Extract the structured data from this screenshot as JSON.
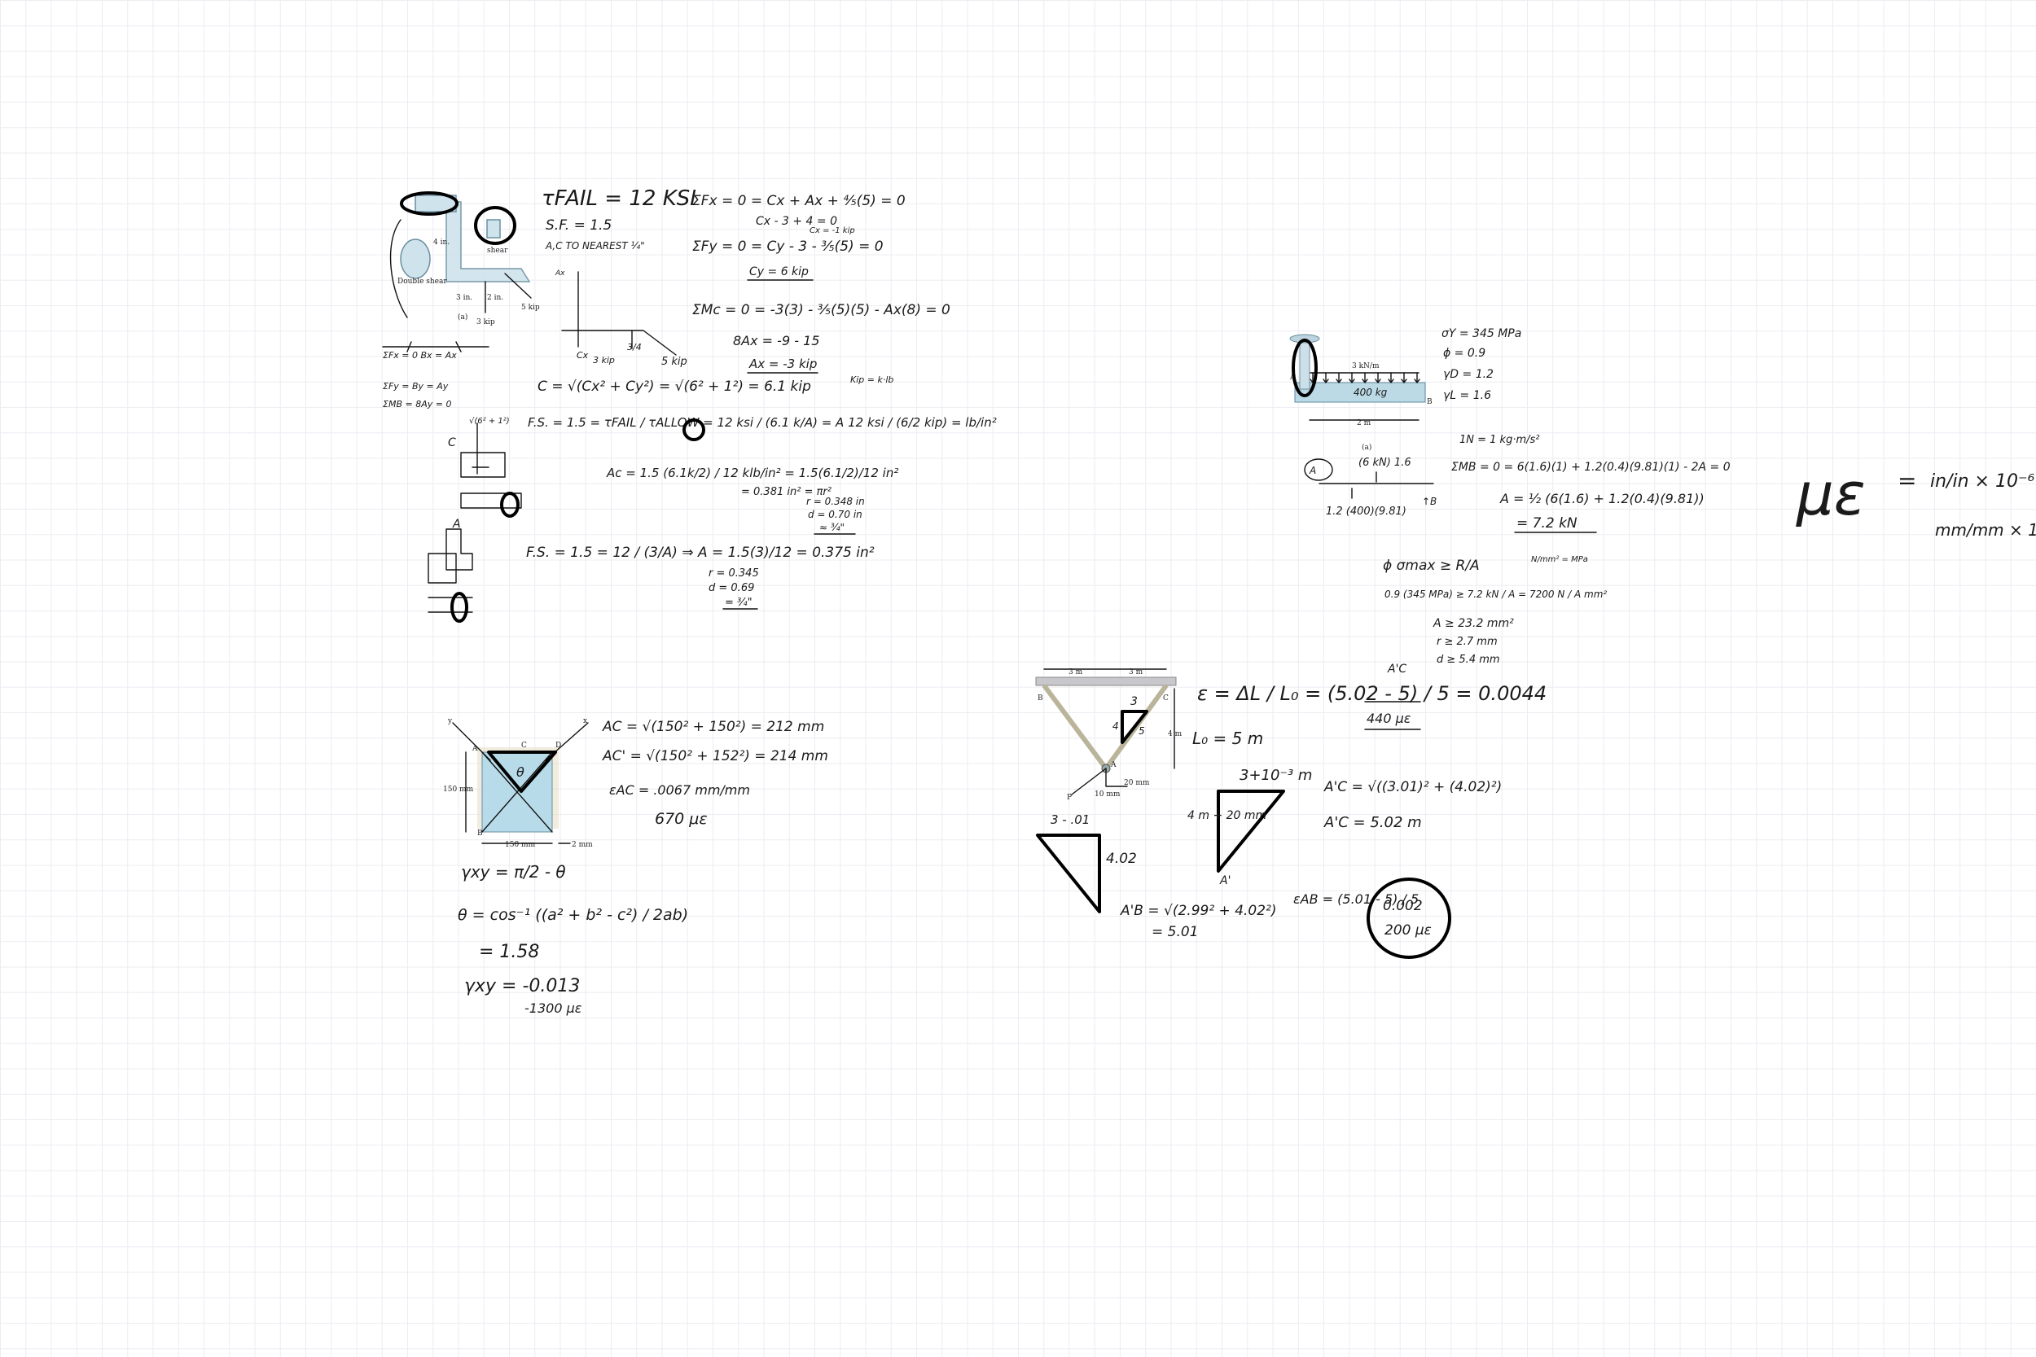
{
  "whiteboard": {
    "problem1": {
      "figure": {
        "caption": "(a)",
        "labels": [
          "shear",
          "Double shear",
          "5 kip",
          "3 kip",
          "3 in.",
          "2 in.",
          "4 in."
        ]
      },
      "notes": {
        "tau_fail": "τFAIL = 12 KSI",
        "sf": "S.F. = 1.5",
        "nearest": "A,C TO NEAREST ¼\"",
        "sum_fx": "ΣFx = 0 = Cx + Ax + ⁴⁄₅(5) = 0",
        "cx_eq": "Cx - 3 + 4 = 0",
        "cx_val": "Cx = -1 kip",
        "sum_fy": "ΣFy = 0 = Cy - 3 - ³⁄₅(5) = 0",
        "cy_val": "Cy = 6 kip",
        "sum_mc": "ΣMc = 0 = -3(3) - ³⁄₅(5)(5) - Ax(8) = 0",
        "ax_eq": "8Ax = -9 - 15",
        "ax_val": "Ax = -3 kip",
        "kip_note": "Kip = k·lb",
        "c_res": "C = √(Cx² + Cy²) = √(6² + 1²) = 6.1 kip",
        "fs_c": "F.S. = 1.5 = τFAIL / τALLOW = 12 ksi / (6.1 k/A) = A 12 ksi / (6/2 kip) = lb/in²",
        "ac_eq": "Ac = 1.5 (6.1k/2) / 12 klb/in² = 1.5(6.1/2)/12 in²",
        "ac_val": "= 0.381 in² = πr²",
        "r_c": "r = 0.348 in",
        "d_c": "d = 0.70 in",
        "d_c_round": "≈ ¾\"",
        "fs_a": "F.S. = 1.5 = 12 / (3/A) ⇒ A = 1.5(3)/12 = 0.375 in²",
        "r_a": "r = 0.345",
        "d_a": "d = 0.69",
        "d_a_round": "= ¾\"",
        "fbd_sum1": "ΣFx = 0   Bx = Ax",
        "fbd_sum2": "ΣFy = By = Ay",
        "fbd_sum3": "ΣMB = 8Ay = 0",
        "fbd_label_c": "C",
        "fbd_label_a": "A",
        "fbd_sqrt": "√(6² + 1²)",
        "kip_5": "5 kip",
        "kip_3": "3 kip",
        "fbd_cx": "Cx",
        "fbd_cy": "Cy",
        "fbd_ax": "Ax",
        "fbd_3_4": "3/4"
      }
    },
    "problem2": {
      "figure": {
        "labels": [
          "3 kN/m",
          "2 m",
          "(a)",
          "A",
          "B"
        ],
        "beam_label": "400 kg"
      },
      "notes": {
        "sigma_y": "σY = 345 MPa",
        "phi": "ϕ = 0.9",
        "gamma_d": "γD = 1.2",
        "gamma_l": "γL = 1.6",
        "newton": "1N = 1 kg·m/s²",
        "load_a": "(6 kN) 1.6",
        "load_dead": "1.2 (400)(9.81)",
        "sum_mb": "ΣMB = 0 = 6(1.6)(1) + 1.2(0.4)(9.81)(1) - 2A = 0",
        "a_eq": "A = ½ (6(1.6) + 1.2(0.4)(9.81))",
        "a_val": "= 7.2 kN",
        "phi_ineq": "ϕ σmax ≥ R/A",
        "units": "N/mm² = MPa",
        "phi_num": "0.9 (345 MPa) ≥ 7.2 kN / A = 7200 N / A mm²",
        "a_min": "A ≥ 23.2 mm²",
        "r_min": "r ≥ 2.7 mm",
        "d_min": "d ≥ 5.4 mm",
        "a_circle": "A",
        "ay": "↑B"
      }
    },
    "problem3": {
      "figure": {
        "labels": [
          "3 m",
          "3 m",
          "B",
          "C",
          "A",
          "4 m",
          "P",
          "10 mm",
          "20 mm"
        ]
      },
      "notes": {
        "epsilon": "ε = ΔL / L₀ = (5.02 - 5) / 5 = 0.0044",
        "a_prime": "A'C",
        "micro": "440 με",
        "lo": "L₀ = 5 m",
        "tri1_top": "3+10⁻³ m",
        "tri1_left": "4 m + 20 mm",
        "tri1_bottom": "A'",
        "ac_prime": "A'C = √((3.01)² + (4.02)²)",
        "ac_prime_val": "A'C = 5.02 m",
        "tri2_top": "3 - .01",
        "tri2_side": "4.02",
        "ab_prime": "A'B = √(2.99² + 4.02²)",
        "ab_prime_val": "= 5.01",
        "eps_ab": "εAB = (5.01 - 5) / 5",
        "result1": "0.002",
        "result2": "200 με",
        "small_tri_top": "3",
        "small_tri_side": "4",
        "small_tri_hyp": "5"
      }
    },
    "problem4": {
      "figure": {
        "labels": [
          "y",
          "x",
          "150 mm",
          "150 mm",
          "2 mm",
          "A",
          "B",
          "C",
          "D",
          "θ"
        ]
      },
      "notes": {
        "ac": "AC = √(150² + 150²) = 212 mm",
        "ac_prime": "AC' = √(150² + 152²) = 214 mm",
        "eps_ac": "εAC = .0067 mm/mm",
        "micro": "670 με",
        "gamma": "γxy = π/2 - θ",
        "theta": "θ = cos⁻¹ ((a² + b² - c²) / 2ab)",
        "theta_val": "= 1.58",
        "gamma_val": "γxy = -0.013",
        "gamma_micro": "-1300 με"
      }
    },
    "side_note": {
      "lhs": "με",
      "eq": "=",
      "rhs1": "in/in × 10⁻⁶",
      "rhs2": "mm/mm × 10⁻⁶"
    }
  }
}
